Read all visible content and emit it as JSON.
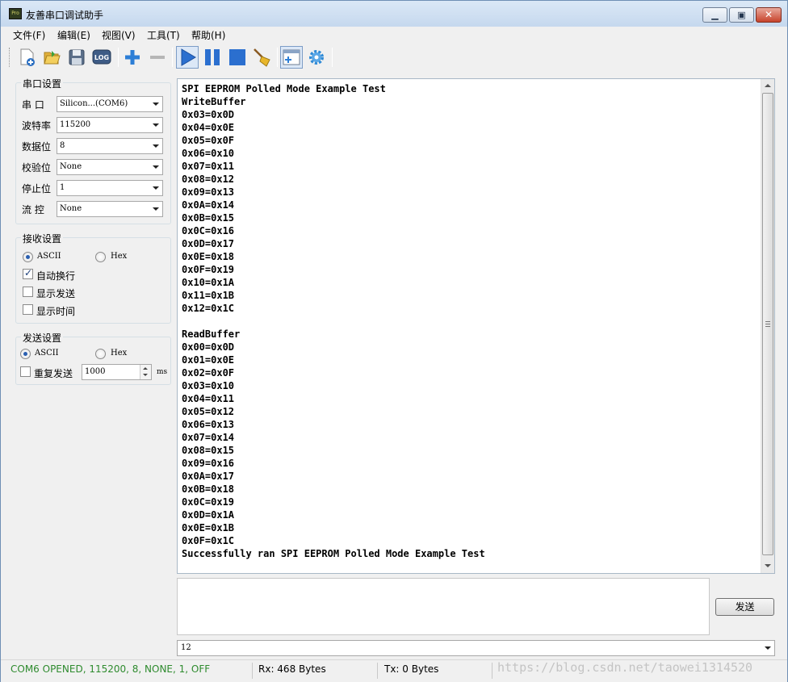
{
  "window": {
    "title": "友善串口调试助手",
    "icon_text": "Pro"
  },
  "menu": [
    {
      "label": "文件(F)"
    },
    {
      "label": "编辑(E)"
    },
    {
      "label": "视图(V)"
    },
    {
      "label": "工具(T)"
    },
    {
      "label": "帮助(H)"
    }
  ],
  "toolbar": {
    "icons": [
      "new-file-icon",
      "open-folder-icon",
      "save-icon",
      "log-icon",
      "add-icon",
      "remove-icon",
      "play-icon",
      "pause-icon",
      "stop-icon",
      "clear-broom-icon",
      "window-toggle-icon",
      "settings-gear-icon"
    ],
    "log_label": "LOG"
  },
  "serial_settings": {
    "title": "串口设置",
    "port_label": "串  口",
    "port_value": "Silicon...(COM6)",
    "baud_label": "波特率",
    "baud_value": "115200",
    "databits_label": "数据位",
    "databits_value": "8",
    "parity_label": "校验位",
    "parity_value": "None",
    "stopbits_label": "停止位",
    "stopbits_value": "1",
    "flow_label": "流  控",
    "flow_value": "None"
  },
  "receive_settings": {
    "title": "接收设置",
    "ascii_label": "ASCII",
    "hex_label": "Hex",
    "ascii_selected": true,
    "auto_wrap_label": "自动换行",
    "auto_wrap_checked": true,
    "show_send_label": "显示发送",
    "show_time_label": "显示时间"
  },
  "send_settings": {
    "title": "发送设置",
    "ascii_label": "ASCII",
    "hex_label": "Hex",
    "repeat_label": "重复发送",
    "interval_value": "1000",
    "interval_unit": "ms"
  },
  "receive_text": "SPI EEPROM Polled Mode Example Test\nWriteBuffer\n0x03=0x0D\n0x04=0x0E\n0x05=0x0F\n0x06=0x10\n0x07=0x11\n0x08=0x12\n0x09=0x13\n0x0A=0x14\n0x0B=0x15\n0x0C=0x16\n0x0D=0x17\n0x0E=0x18\n0x0F=0x19\n0x10=0x1A\n0x11=0x1B\n0x12=0x1C\n\nReadBuffer\n0x00=0x0D\n0x01=0x0E\n0x02=0x0F\n0x03=0x10\n0x04=0x11\n0x05=0x12\n0x06=0x13\n0x07=0x14\n0x08=0x15\n0x09=0x16\n0x0A=0x17\n0x0B=0x18\n0x0C=0x19\n0x0D=0x1A\n0x0E=0x1B\n0x0F=0x1C\nSuccessfully ran SPI EEPROM Polled Mode Example Test",
  "send": {
    "input_value": "",
    "button_label": "发送",
    "history_value": "12"
  },
  "status": {
    "connection": "COM6 OPENED, 115200, 8, NONE, 1, OFF",
    "rx": "Rx: 468 Bytes",
    "tx": "Tx: 0 Bytes",
    "watermark": "https://blog.csdn.net/taowei1314520",
    "connection_color": "#2e8b2e"
  }
}
